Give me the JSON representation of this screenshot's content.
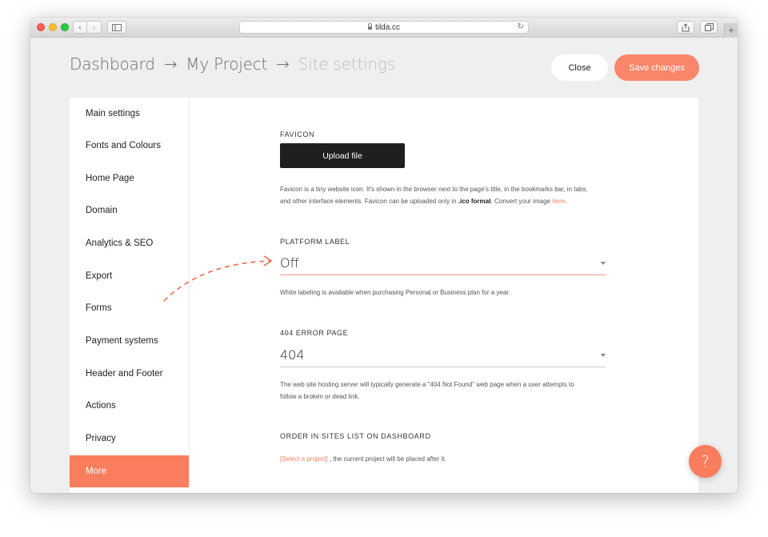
{
  "browser": {
    "url": "tilda.cc",
    "reload_icon": "reload-icon",
    "new_tab_symbol": "+",
    "back_symbol": "‹",
    "forward_symbol": "›"
  },
  "header": {
    "breadcrumb": [
      "Dashboard",
      "My Project",
      "Site settings"
    ],
    "arrow": "→",
    "close_label": "Close",
    "save_label": "Save changes"
  },
  "sidebar": {
    "items": [
      {
        "label": "Main settings"
      },
      {
        "label": "Fonts and Colours"
      },
      {
        "label": "Home Page"
      },
      {
        "label": "Domain"
      },
      {
        "label": "Analytics & SEO"
      },
      {
        "label": "Export"
      },
      {
        "label": "Forms"
      },
      {
        "label": "Payment systems"
      },
      {
        "label": "Header and Footer"
      },
      {
        "label": "Actions"
      },
      {
        "label": "Privacy"
      },
      {
        "label": "More"
      }
    ],
    "active": "More"
  },
  "favicon": {
    "label": "FAVICON",
    "button": "Upload file",
    "desc_line1": "Favicon is a tiny website icon. It's shown in the browser next to the page's title, in the bookmarks bar, in tabs,",
    "desc_line2a": "and other interface elements. Favicon can be uploaded only in ",
    "desc_bold": ".ico format",
    "desc_line2b": ". Convert your image ",
    "desc_link": "here",
    "desc_end": "."
  },
  "platform_label": {
    "label": "PLATFORM LABEL",
    "value": "Off",
    "desc": "White labeling is available when purchasing Personal or Business plan for a year."
  },
  "error_page": {
    "label": "404 ERROR PAGE",
    "value": "404",
    "desc_line1": "The web site hosting server will typically generate a \"404 Not Found\" web page when a user attempts to",
    "desc_line2": "follow a broken or dead link."
  },
  "order": {
    "label": "ORDER IN SITES LIST ON DASHBOARD",
    "link": "[Select a project]",
    "text": " , the current project will be placed after it."
  },
  "help": {
    "symbol": "?"
  },
  "colors": {
    "accent": "#fa7d5e",
    "dark_button": "#1f1f1f",
    "background": "#efefef"
  }
}
